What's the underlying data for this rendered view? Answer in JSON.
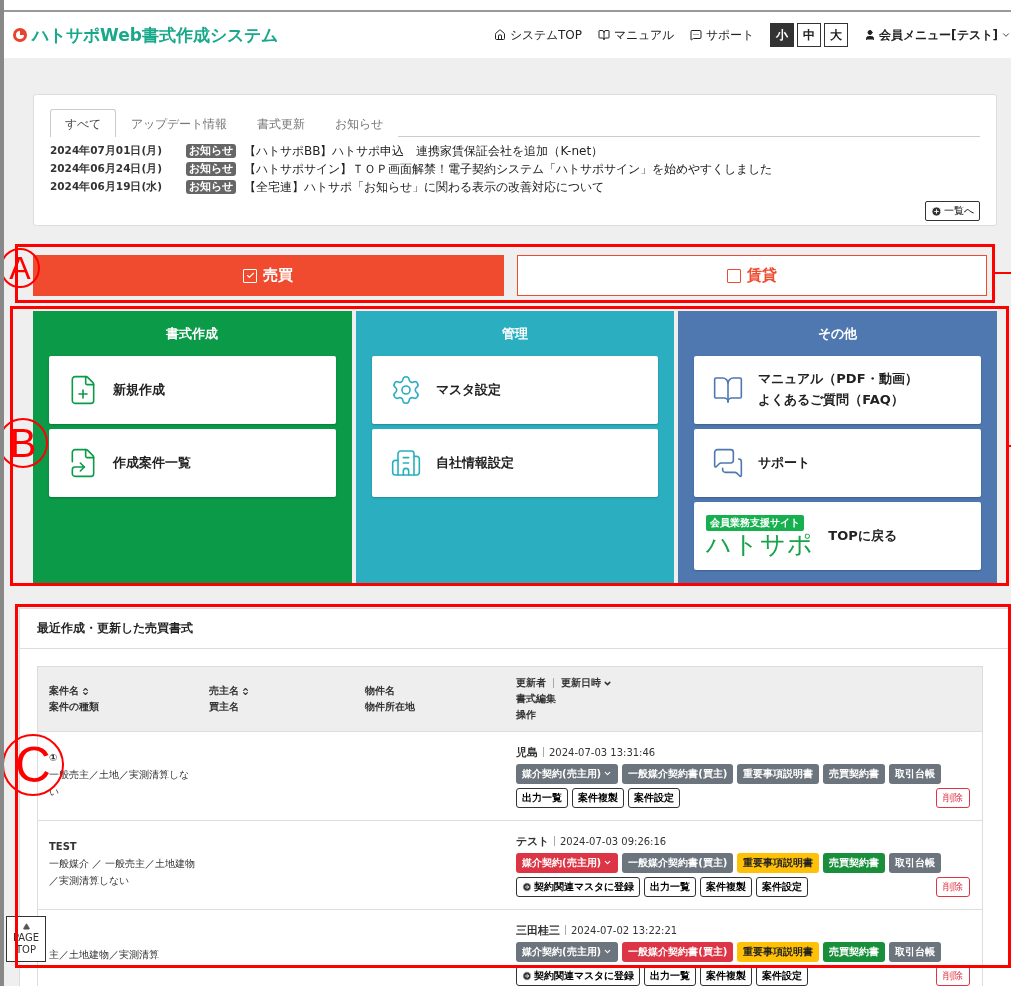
{
  "header": {
    "logo": "ハトサポWeb書式作成システム",
    "nav": [
      {
        "kind": "home",
        "label": "システムTOP"
      },
      {
        "kind": "book",
        "label": "マニュアル"
      },
      {
        "kind": "chat",
        "label": "サポート"
      }
    ],
    "font_sizes": [
      {
        "label": "小",
        "selected": true
      },
      {
        "label": "中",
        "selected": false
      },
      {
        "label": "大",
        "selected": false
      }
    ],
    "user_menu": "会員メニュー[テスト]"
  },
  "news": {
    "tabs": [
      {
        "label": "すべて",
        "selected": true
      },
      {
        "label": "アップデート情報",
        "selected": false
      },
      {
        "label": "書式更新",
        "selected": false
      },
      {
        "label": "お知らせ",
        "selected": false
      }
    ],
    "items": [
      {
        "date": "2024年07月01日(月)",
        "badge": "お知らせ",
        "text": "【ハトサポBB】ハトサポ申込　連携家賃保証会社を追加（K-net）"
      },
      {
        "date": "2024年06月24日(月)",
        "badge": "お知らせ",
        "text": "【ハトサポサイン】ＴＯＰ画面解禁！電子契約システム「ハトサポサイン」を始めやすくしました"
      },
      {
        "date": "2024年06月19日(水)",
        "badge": "お知らせ",
        "text": "【全宅連】ハトサポ「お知らせ」に関わる表示の改善対応について"
      }
    ],
    "more": "一覧へ"
  },
  "mode": [
    {
      "label": "売買",
      "selected": true
    },
    {
      "label": "賃貸",
      "selected": false
    }
  ],
  "panels": [
    {
      "kind": "green",
      "title": "書式作成",
      "items": [
        {
          "kind": "card",
          "lines": [
            "新規作成"
          ]
        },
        {
          "kind": "card",
          "lines": [
            "作成案件一覧"
          ]
        }
      ]
    },
    {
      "kind": "teal",
      "title": "管理",
      "items": [
        {
          "kind": "card",
          "lines": [
            "マスタ設定"
          ]
        },
        {
          "kind": "card",
          "lines": [
            "自社情報設定"
          ]
        }
      ]
    },
    {
      "kind": "blue",
      "title": "その他",
      "items": [
        {
          "kind": "card",
          "lines": [
            "マニュアル（PDF・動画）",
            "よくあるご質問（FAQ）"
          ]
        },
        {
          "kind": "card",
          "lines": [
            "サポート"
          ]
        },
        {
          "kind": "logo",
          "logo_caption": "会員業務支援サイト",
          "logo_text": "ハトサポ",
          "lines": [
            "TOPに戻る"
          ]
        }
      ]
    }
  ],
  "recent": {
    "title": "最近作成・更新した売買書式",
    "columns": [
      {
        "lines": [
          "案件名",
          "案件の種類"
        ],
        "sortable": true
      },
      {
        "lines": [
          "売主名",
          "買主名"
        ],
        "sortable": true
      },
      {
        "lines": [
          "物件名",
          "物件所在地"
        ],
        "sortable": false
      },
      {
        "lines": [
          "更新者",
          "更新日時",
          "書式編集",
          "操作"
        ],
        "sortable": true
      }
    ],
    "rows": [
      {
        "name": "①",
        "type": "一般売主／土地／実測清算しない",
        "updater": "児島",
        "updated": "2024-07-03 13:31:46",
        "docs": [
          {
            "kind": "dark",
            "label": "媒介契約(売主用)",
            "dropdown": true
          },
          {
            "kind": "dark",
            "label": "一般媒介契約書(買主)",
            "dropdown": false
          },
          {
            "kind": "dark",
            "label": "重要事項説明書",
            "dropdown": false
          },
          {
            "kind": "dark",
            "label": "売買契約書",
            "dropdown": false
          },
          {
            "kind": "dark",
            "label": "取引台帳",
            "dropdown": false
          }
        ],
        "actions": [
          {
            "kind": "outline",
            "label": "出力一覧"
          },
          {
            "kind": "outline",
            "label": "案件複製"
          },
          {
            "kind": "outline",
            "label": "案件設定"
          }
        ],
        "delete": "削除"
      },
      {
        "name": "TEST",
        "type": "一般媒介 ／ 一般売主／土地建物／実測清算しない",
        "updater": "テスト",
        "updated": "2024-07-03 09:26:16",
        "docs": [
          {
            "kind": "danger",
            "label": "媒介契約(売主用)",
            "dropdown": true
          },
          {
            "kind": "dark",
            "label": "一般媒介契約書(買主)",
            "dropdown": false
          },
          {
            "kind": "warning",
            "label": "重要事項説明書",
            "dropdown": false
          },
          {
            "kind": "success",
            "label": "売買契約書",
            "dropdown": false
          },
          {
            "kind": "dark",
            "label": "取引台帳",
            "dropdown": false
          }
        ],
        "actions": [
          {
            "kind": "register",
            "label": "契約関連マスタに登録"
          },
          {
            "kind": "outline",
            "label": "出力一覧"
          },
          {
            "kind": "outline",
            "label": "案件複製"
          },
          {
            "kind": "outline",
            "label": "案件設定"
          }
        ],
        "delete": "削除"
      },
      {
        "type": "主／土地建物／実測清算",
        "updater": "三田桂三",
        "updated": "2024-07-02 13:22:21",
        "docs": [
          {
            "kind": "dark",
            "label": "媒介契約(売主用)",
            "dropdown": true
          },
          {
            "kind": "danger",
            "label": "一般媒介契約書(買主)",
            "dropdown": false
          },
          {
            "kind": "warning",
            "label": "重要事項説明書",
            "dropdown": false
          },
          {
            "kind": "success",
            "label": "売買契約書",
            "dropdown": false
          },
          {
            "kind": "dark",
            "label": "取引台帳",
            "dropdown": false
          }
        ],
        "actions": [
          {
            "kind": "register",
            "label": "契約関連マスタに登録"
          },
          {
            "kind": "outline",
            "label": "出力一覧"
          },
          {
            "kind": "outline",
            "label": "案件複製"
          },
          {
            "kind": "outline",
            "label": "案件設定"
          }
        ],
        "delete": "削除"
      }
    ]
  },
  "page_top": "PAGE TOP",
  "annotations": [
    {
      "label": "A"
    },
    {
      "label": "B"
    },
    {
      "label": "C"
    }
  ]
}
